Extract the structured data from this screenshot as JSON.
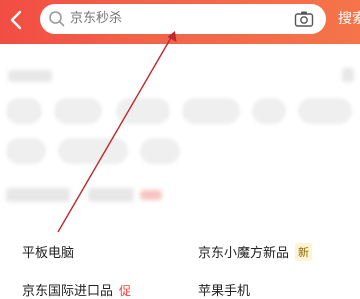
{
  "header": {
    "search_placeholder": "京东秒杀",
    "search_button_label": "搜索"
  },
  "list": {
    "rows": [
      {
        "left": "平板电脑",
        "right": "京东小魔方新品",
        "right_badge": "新"
      },
      {
        "left": "京东国际进口品",
        "left_badge": "促",
        "right": "苹果手机"
      }
    ]
  },
  "colors": {
    "header_gradient_start": "#f24d43",
    "header_gradient_end": "#f5744a",
    "annotation_arrow": "#c1272d"
  },
  "icons": [
    "back-chevron-icon",
    "search-icon",
    "camera-icon"
  ]
}
